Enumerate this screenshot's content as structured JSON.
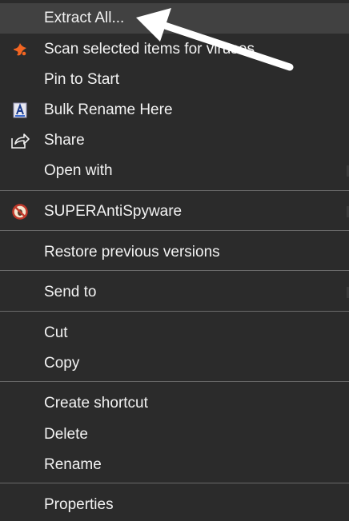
{
  "menu": {
    "items": [
      {
        "label": "Extract All...",
        "icon": "none"
      },
      {
        "label": "Scan selected items for viruses",
        "icon": "avast-icon"
      },
      {
        "label": "Pin to Start",
        "icon": "none"
      },
      {
        "label": "Bulk Rename Here",
        "icon": "bulk-rename-icon"
      },
      {
        "label": "Share",
        "icon": "share-icon"
      },
      {
        "label": "Open with",
        "icon": "none"
      },
      {
        "label": "SUPERAntiSpyware",
        "icon": "superantispyware-icon"
      },
      {
        "label": "Restore previous versions",
        "icon": "none"
      },
      {
        "label": "Send to",
        "icon": "none"
      },
      {
        "label": "Cut",
        "icon": "none"
      },
      {
        "label": "Copy",
        "icon": "none"
      },
      {
        "label": "Create shortcut",
        "icon": "none"
      },
      {
        "label": "Delete",
        "icon": "none"
      },
      {
        "label": "Rename",
        "icon": "none"
      },
      {
        "label": "Properties",
        "icon": "none"
      }
    ]
  },
  "annotation": {
    "arrow_color": "#ffffff",
    "points_to": "Extract All..."
  },
  "colors": {
    "background": "#2b2b2b",
    "highlight": "#414141",
    "separator": "#6a6a6a",
    "text": "#f2f2f2",
    "avast_orange": "#f26522",
    "superantispyware_red": "#c0392b"
  }
}
